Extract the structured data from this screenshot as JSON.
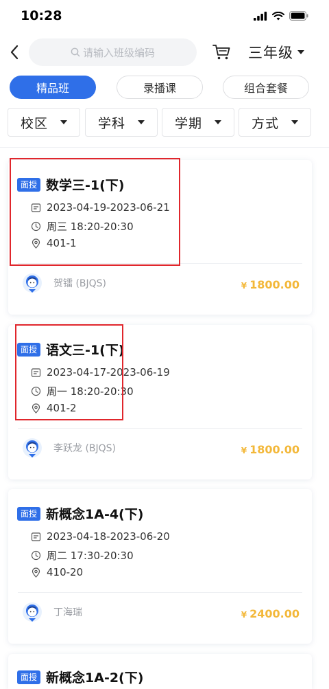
{
  "status_bar": {
    "time": "10:28"
  },
  "nav": {
    "search_placeholder": "请输入班级编码",
    "grade": "三年级"
  },
  "type_tabs": [
    {
      "label": "精品班",
      "active": true
    },
    {
      "label": "录播课",
      "active": false
    },
    {
      "label": "组合套餐",
      "active": false
    }
  ],
  "filters": [
    {
      "label": "校区"
    },
    {
      "label": "学科"
    },
    {
      "label": "学期"
    },
    {
      "label": "方式"
    }
  ],
  "courses": [
    {
      "tag": "面授",
      "title": "数学三-1(下)",
      "dates": "2023-04-19-2023-06-21",
      "schedule": "周三  18:20-20:30",
      "room": "401-1",
      "teacher": "贺镭 (BJQS)",
      "currency": "¥",
      "price": "1800.00"
    },
    {
      "tag": "面授",
      "title": "语文三-1(下)",
      "dates": "2023-04-17-2023-06-19",
      "schedule": "周一  18:20-20:30",
      "room": "401-2",
      "teacher": "李跃龙 (BJQS)",
      "currency": "¥",
      "price": "1800.00"
    },
    {
      "tag": "面授",
      "title": "新概念1A-4(下)",
      "dates": "2023-04-18-2023-06-20",
      "schedule": "周二  17:30-20:30",
      "room": "410-20",
      "teacher": "丁海瑞",
      "currency": "¥",
      "price": "2400.00"
    },
    {
      "tag": "面授",
      "title": "新概念1A-2(下)"
    }
  ],
  "colors": {
    "primary": "#2f6fe8",
    "price": "#f3b83a",
    "highlight": "#e0262c"
  }
}
